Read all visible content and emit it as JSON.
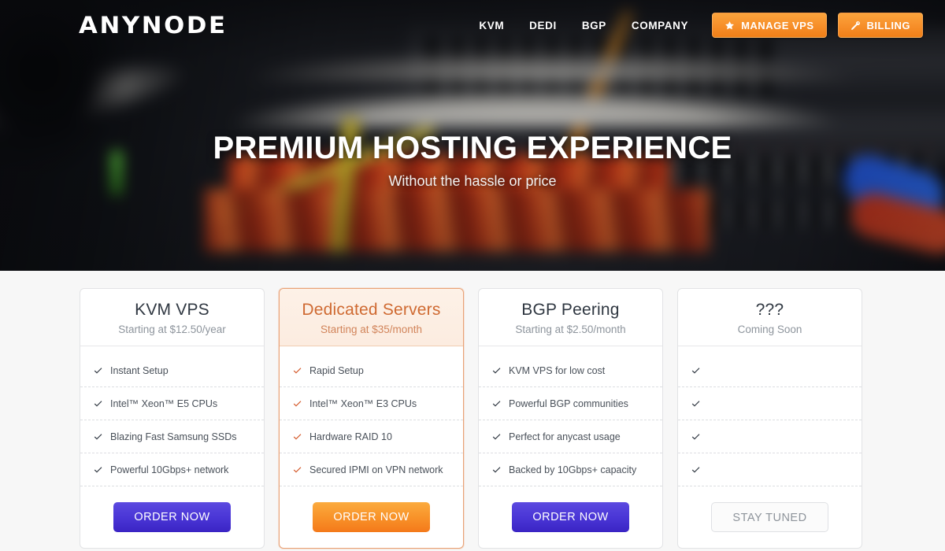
{
  "brand": {
    "logo": "ANYNODE"
  },
  "nav": {
    "links": [
      {
        "label": "KVM"
      },
      {
        "label": "DEDI"
      },
      {
        "label": "BGP"
      },
      {
        "label": "COMPANY"
      }
    ],
    "buttons": [
      {
        "label": "MANAGE VPS",
        "icon": "star-icon",
        "color": "#f7912c"
      },
      {
        "label": "BILLING",
        "icon": "key-icon",
        "color": "#f7912c"
      }
    ]
  },
  "hero": {
    "title": "PREMIUM HOSTING EXPERIENCE",
    "subtitle": "Without the hassle or price"
  },
  "pricing": {
    "cards": [
      {
        "title": "KVM VPS",
        "subtitle": "Starting at $12.50/year",
        "featured": false,
        "check_color": "#2f3741",
        "features": [
          "Instant Setup",
          "Intel™ Xeon™ E5 CPUs",
          "Blazing Fast Samsung SSDs",
          "Powerful 10Gbps+ network"
        ],
        "button": {
          "label": "ORDER NOW",
          "style": "purple"
        }
      },
      {
        "title": "Dedicated Servers",
        "subtitle": "Starting at $35/month",
        "featured": true,
        "check_color": "#d4592a",
        "features": [
          "Rapid Setup",
          "Intel™ Xeon™ E3 CPUs",
          "Hardware RAID 10",
          "Secured IPMI on VPN network"
        ],
        "button": {
          "label": "ORDER NOW",
          "style": "orange"
        }
      },
      {
        "title": "BGP Peering",
        "subtitle": "Starting at $2.50/month",
        "featured": false,
        "check_color": "#2f3741",
        "features": [
          "KVM VPS for low cost",
          "Powerful BGP communities",
          "Perfect for anycast usage",
          "Backed by 10Gbps+ capacity"
        ],
        "button": {
          "label": "ORDER NOW",
          "style": "purple"
        }
      },
      {
        "title": "???",
        "subtitle": "Coming Soon",
        "featured": false,
        "check_color": "#2f3741",
        "features": [
          "",
          "",
          "",
          ""
        ],
        "button": {
          "label": "STAY TUNED",
          "style": "ghost"
        }
      }
    ]
  }
}
